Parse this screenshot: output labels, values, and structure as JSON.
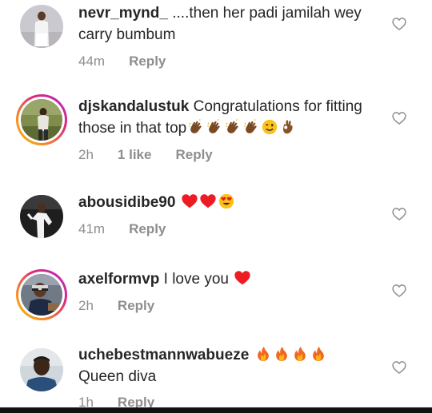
{
  "comments": [
    {
      "username": "nevr_mynd_",
      "text": " ....then her padi jamilah wey carry bumbum",
      "time": "44m",
      "likes": "",
      "reply": "Reply",
      "emojis": []
    },
    {
      "username": "djskandalustuk",
      "text": " Congratulations for fitting those in that top",
      "time": "2h",
      "likes": "1 like",
      "reply": "Reply",
      "emojis": [
        "clap",
        "clap",
        "clap",
        "clap",
        "wink",
        "ok-hand"
      ]
    },
    {
      "username": "abousidibe90",
      "text": " ",
      "time": "41m",
      "likes": "",
      "reply": "Reply",
      "emojis": [
        "red-heart",
        "red-heart",
        "heart-eyes"
      ]
    },
    {
      "username": "axelformvp",
      "text": " I love you ",
      "time": "2h",
      "likes": "",
      "reply": "Reply",
      "emojis": [
        "red-heart"
      ]
    },
    {
      "username": "uchebestmannwabueze",
      "text": " ",
      "text2": "Queen diva",
      "time": "1h",
      "likes": "",
      "reply": "Reply",
      "emojis": [
        "fire",
        "fire",
        "fire",
        "fire"
      ]
    }
  ],
  "colors": {
    "text": "#262626",
    "meta": "#8e8e8e",
    "heart_red": "#ed1c24"
  },
  "icons": {
    "like": "heart-outline-icon"
  }
}
